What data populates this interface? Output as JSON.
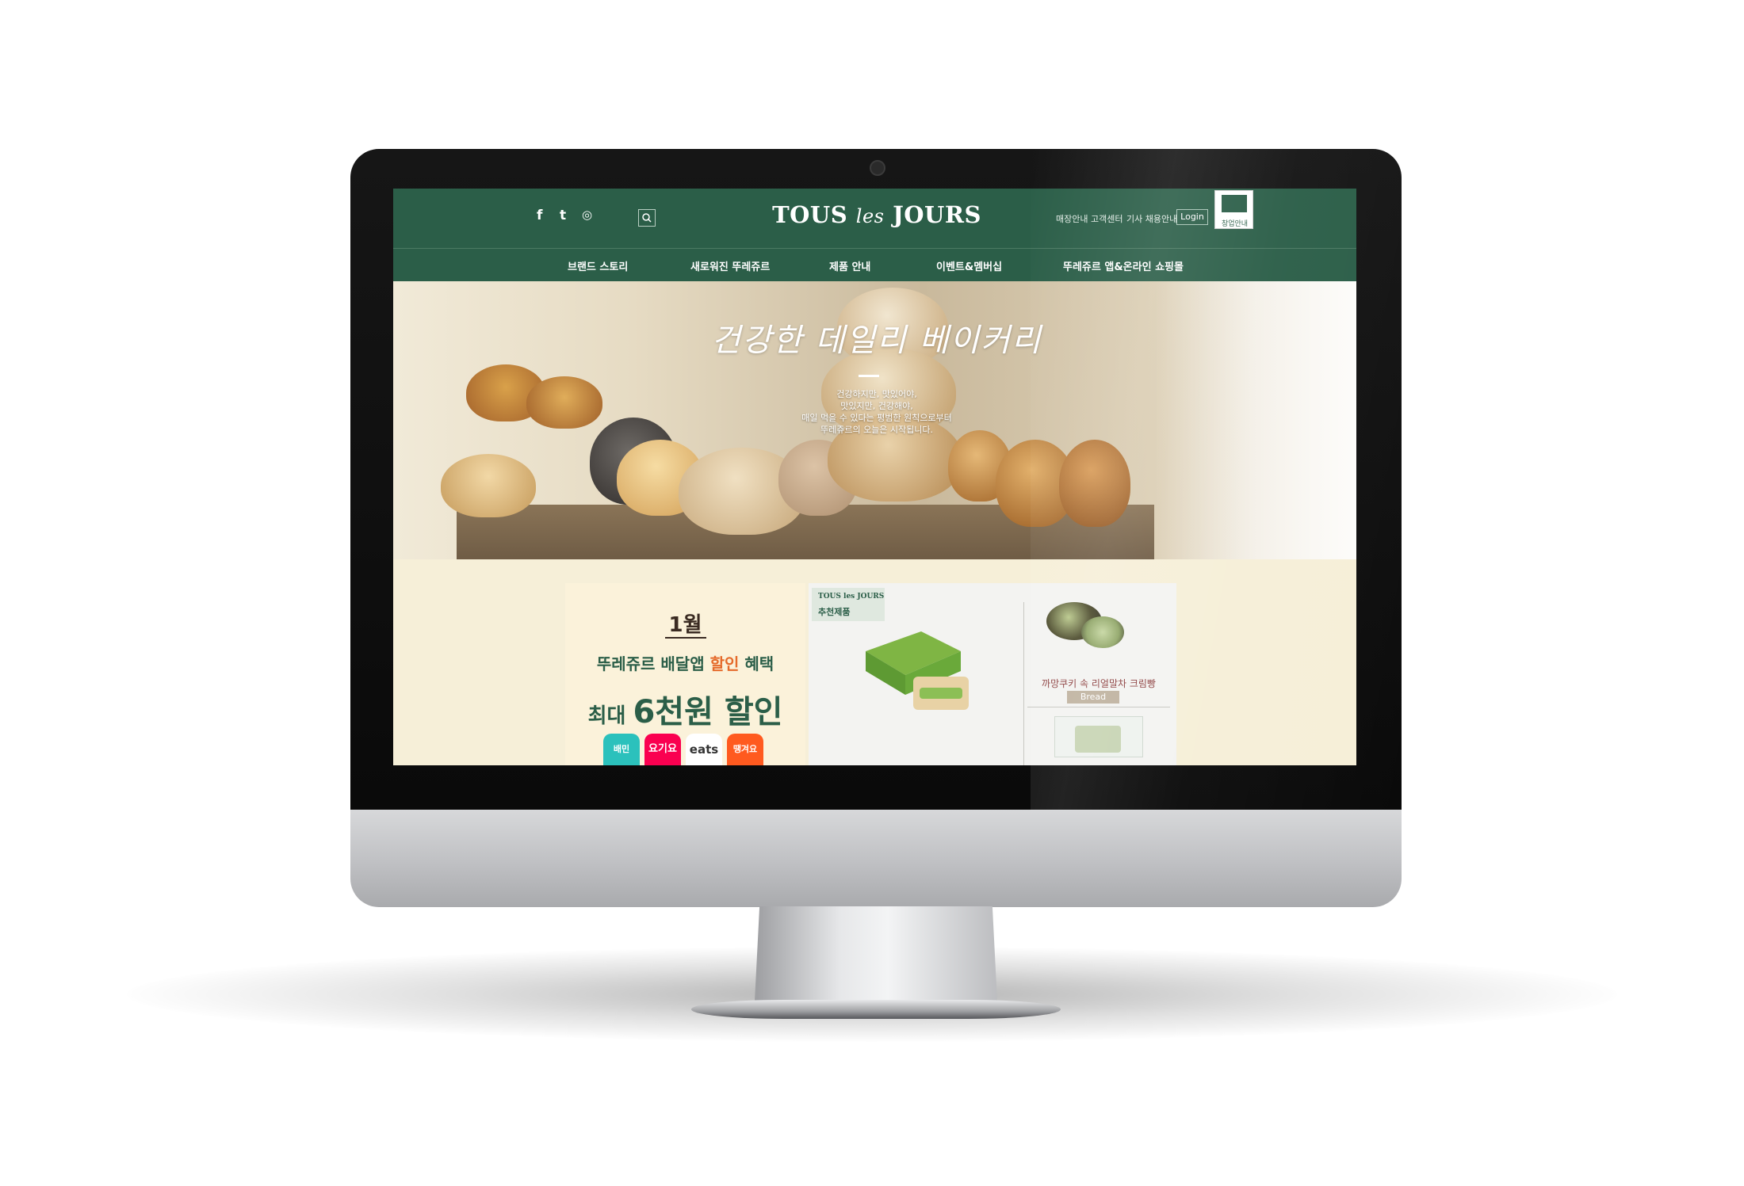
{
  "header": {
    "logo": {
      "main": "TOUS",
      "middle": "les",
      "end": "JOURS"
    },
    "social": {
      "facebook": "f",
      "tumblr": "t",
      "instagram": "◎"
    },
    "search_icon": "search-icon",
    "utility_links": [
      "매장안내",
      "고객센터",
      "기사 채용안내"
    ],
    "login_label": "Login",
    "store_open_label": "창업안내"
  },
  "nav": {
    "items": [
      "브랜드 스토리",
      "새로워진 뚜레쥬르",
      "제품 안내",
      "이벤트&멤버십",
      "뚜레쥬르 앱&온라인 쇼핑몰"
    ]
  },
  "hero": {
    "title": "건강한 데일리 베이커리",
    "lines": [
      "건강하지만, 맛있어야,",
      "맛있지만, 건강해야,",
      "매일 먹을 수 있다는 평범한 원칙으로부터",
      "뚜레쥬르의 오늘은 시작됩니다."
    ]
  },
  "promo": {
    "month": "1월",
    "line1_a": "뚜레쥬르 배달앱 ",
    "line1_hl": "할인",
    "line1_b": " 혜택",
    "line2_a": "최대 ",
    "line2_big": "6천원 할인",
    "apps": [
      "배민",
      "요기요",
      "eats",
      "땡겨요"
    ]
  },
  "recommend": {
    "brand": "TOUS les JOURS",
    "label": "추천제품",
    "product_name": "까망쿠키 속 리얼말차 크림빵",
    "product_tag": "Bread"
  },
  "colors": {
    "brand_green": "#2b5e48",
    "accent_orange": "#e56a2a",
    "promo_bg": "#fbf2da"
  }
}
